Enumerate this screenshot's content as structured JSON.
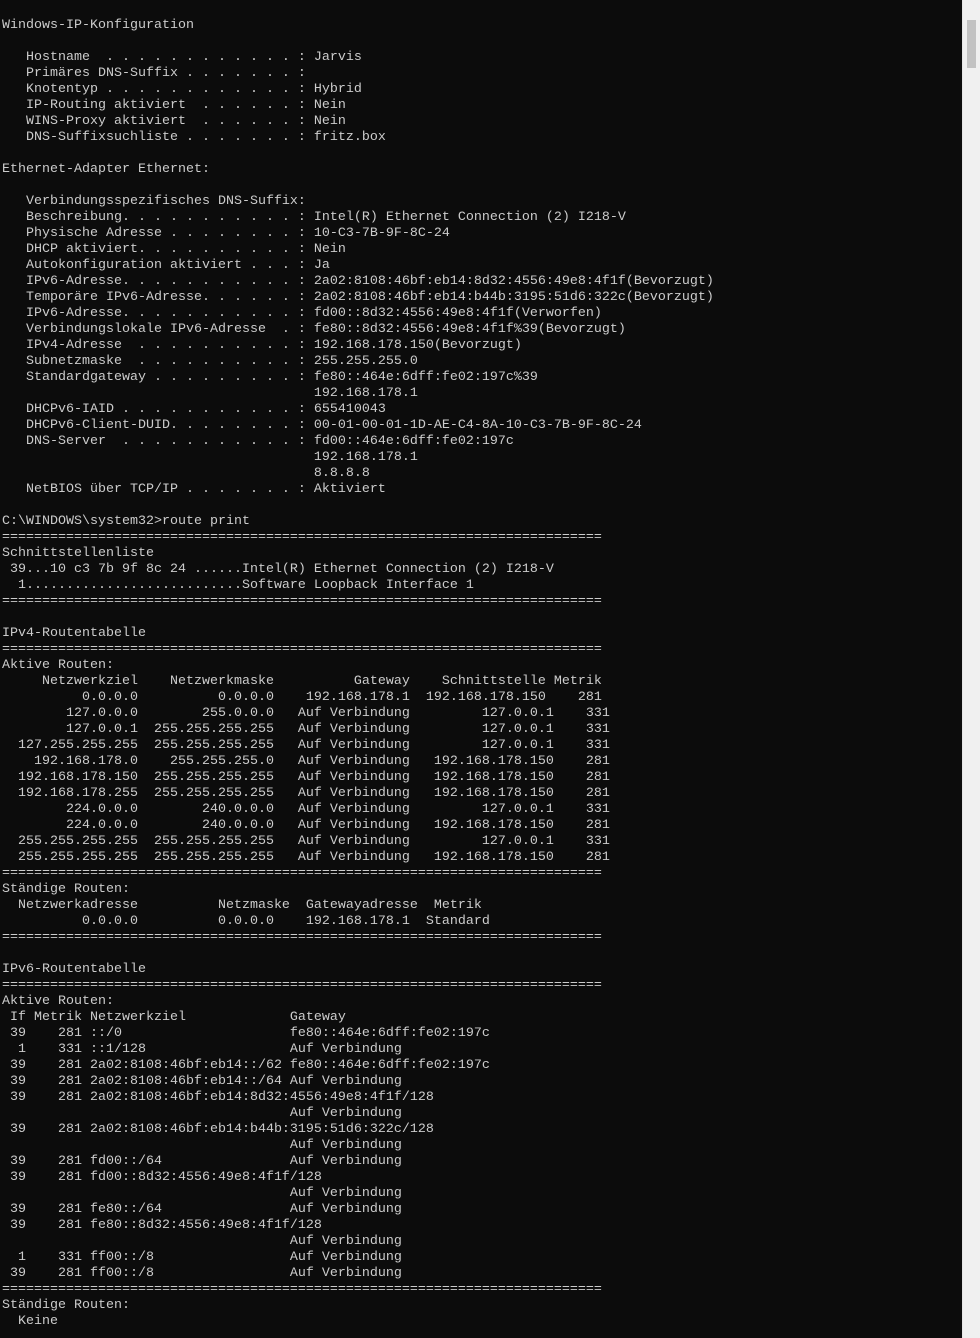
{
  "window": {
    "app": "Windows Command Prompt"
  },
  "console": {
    "lines": [
      "Windows-IP-Konfiguration",
      "",
      "   Hostname  . . . . . . . . . . . . : Jarvis",
      "   Primäres DNS-Suffix . . . . . . . :",
      "   Knotentyp . . . . . . . . . . . . : Hybrid",
      "   IP-Routing aktiviert  . . . . . . : Nein",
      "   WINS-Proxy aktiviert  . . . . . . : Nein",
      "   DNS-Suffixsuchliste . . . . . . . : fritz.box",
      "",
      "Ethernet-Adapter Ethernet:",
      "",
      "   Verbindungsspezifisches DNS-Suffix:",
      "   Beschreibung. . . . . . . . . . . : Intel(R) Ethernet Connection (2) I218-V",
      "   Physische Adresse . . . . . . . . : 10-C3-7B-9F-8C-24",
      "   DHCP aktiviert. . . . . . . . . . : Nein",
      "   Autokonfiguration aktiviert . . . : Ja",
      "   IPv6-Adresse. . . . . . . . . . . : 2a02:8108:46bf:eb14:8d32:4556:49e8:4f1f(Bevorzugt)",
      "   Temporäre IPv6-Adresse. . . . . . : 2a02:8108:46bf:eb14:b44b:3195:51d6:322c(Bevorzugt)",
      "   IPv6-Adresse. . . . . . . . . . . : fd00::8d32:4556:49e8:4f1f(Verworfen)",
      "   Verbindungslokale IPv6-Adresse  . : fe80::8d32:4556:49e8:4f1f%39(Bevorzugt)",
      "   IPv4-Adresse  . . . . . . . . . . : 192.168.178.150(Bevorzugt)",
      "   Subnetzmaske  . . . . . . . . . . : 255.255.255.0",
      "   Standardgateway . . . . . . . . . : fe80::464e:6dff:fe02:197c%39",
      "                                       192.168.178.1",
      "   DHCPv6-IAID . . . . . . . . . . . : 655410043",
      "   DHCPv6-Client-DUID. . . . . . . . : 00-01-00-01-1D-AE-C4-8A-10-C3-7B-9F-8C-24",
      "   DNS-Server  . . . . . . . . . . . : fd00::464e:6dff:fe02:197c",
      "                                       192.168.178.1",
      "                                       8.8.8.8",
      "   NetBIOS über TCP/IP . . . . . . . : Aktiviert",
      "",
      "C:\\WINDOWS\\system32>route print",
      "===========================================================================",
      "Schnittstellenliste",
      " 39...10 c3 7b 9f 8c 24 ......Intel(R) Ethernet Connection (2) I218-V",
      "  1...........................Software Loopback Interface 1",
      "===========================================================================",
      "",
      "IPv4-Routentabelle",
      "===========================================================================",
      "Aktive Routen:",
      "     Netzwerkziel    Netzwerkmaske          Gateway    Schnittstelle Metrik",
      "          0.0.0.0          0.0.0.0    192.168.178.1  192.168.178.150    281",
      "        127.0.0.0        255.0.0.0   Auf Verbindung         127.0.0.1    331",
      "        127.0.0.1  255.255.255.255   Auf Verbindung         127.0.0.1    331",
      "  127.255.255.255  255.255.255.255   Auf Verbindung         127.0.0.1    331",
      "    192.168.178.0    255.255.255.0   Auf Verbindung   192.168.178.150    281",
      "  192.168.178.150  255.255.255.255   Auf Verbindung   192.168.178.150    281",
      "  192.168.178.255  255.255.255.255   Auf Verbindung   192.168.178.150    281",
      "        224.0.0.0        240.0.0.0   Auf Verbindung         127.0.0.1    331",
      "        224.0.0.0        240.0.0.0   Auf Verbindung   192.168.178.150    281",
      "  255.255.255.255  255.255.255.255   Auf Verbindung         127.0.0.1    331",
      "  255.255.255.255  255.255.255.255   Auf Verbindung   192.168.178.150    281",
      "===========================================================================",
      "Ständige Routen:",
      "  Netzwerkadresse          Netzmaske  Gatewayadresse  Metrik",
      "          0.0.0.0          0.0.0.0    192.168.178.1  Standard",
      "===========================================================================",
      "",
      "IPv6-Routentabelle",
      "===========================================================================",
      "Aktive Routen:",
      " If Metrik Netzwerkziel             Gateway",
      " 39    281 ::/0                     fe80::464e:6dff:fe02:197c",
      "  1    331 ::1/128                  Auf Verbindung",
      " 39    281 2a02:8108:46bf:eb14::/62 fe80::464e:6dff:fe02:197c",
      " 39    281 2a02:8108:46bf:eb14::/64 Auf Verbindung",
      " 39    281 2a02:8108:46bf:eb14:8d32:4556:49e8:4f1f/128",
      "                                    Auf Verbindung",
      " 39    281 2a02:8108:46bf:eb14:b44b:3195:51d6:322c/128",
      "                                    Auf Verbindung",
      " 39    281 fd00::/64                Auf Verbindung",
      " 39    281 fd00::8d32:4556:49e8:4f1f/128",
      "                                    Auf Verbindung",
      " 39    281 fe80::/64                Auf Verbindung",
      " 39    281 fe80::8d32:4556:49e8:4f1f/128",
      "                                    Auf Verbindung",
      "  1    331 ff00::/8                 Auf Verbindung",
      " 39    281 ff00::/8                 Auf Verbindung",
      "===========================================================================",
      "Ständige Routen:",
      "  Keine"
    ]
  },
  "colors": {
    "background": "#0c0c0c",
    "text": "#cccccc",
    "scrollbar_track": "#f0f0f0",
    "scrollbar_thumb": "#c2c2c2"
  }
}
